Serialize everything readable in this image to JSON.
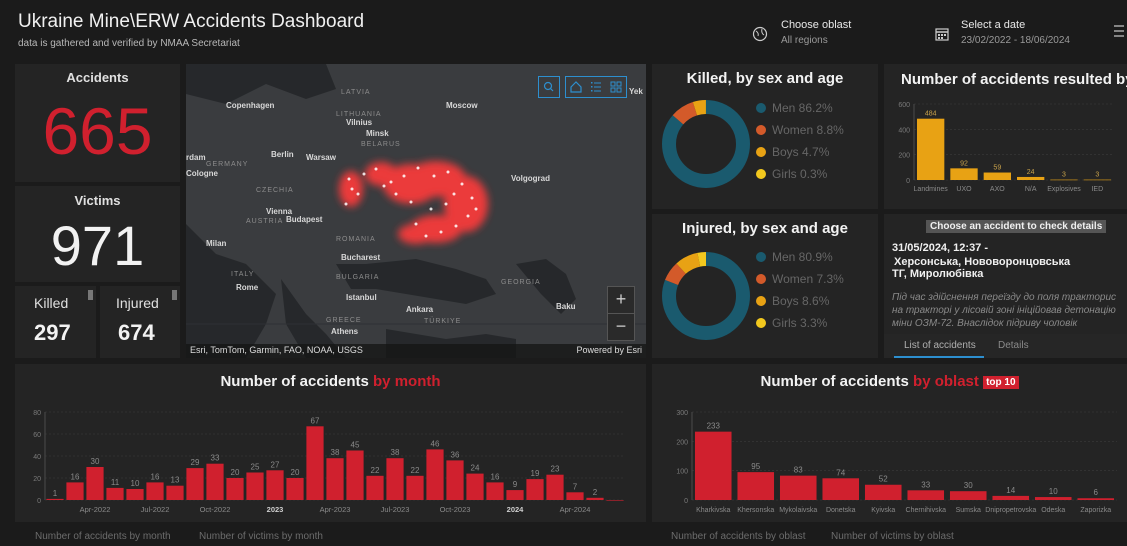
{
  "header": {
    "title": "Ukraine Mine\\ERW Accidents Dashboard",
    "subtitle": "data is gathered and verified by NMAA Secretariat",
    "oblast_label": "Choose oblast",
    "oblast_value": "All regions",
    "date_label": "Select a date",
    "date_value": "23/02/2022 - 18/06/2024"
  },
  "indicators": {
    "accidents_label": "Accidents",
    "accidents_value": "665",
    "victims_label": "Victims",
    "victims_value": "971",
    "killed_label": "Killed",
    "killed_value": "297",
    "injured_label": "Injured",
    "injured_value": "674"
  },
  "map": {
    "labels": [
      "LATVIA",
      "Moscow",
      "Copenhagen",
      "LITHUANIA",
      "Vilnius",
      "Minsk",
      "BELARUS",
      "Berlin",
      "GERMANY",
      "rdam",
      "Cologne",
      "Warsaw",
      "CZECHIA",
      "Vienna",
      "AUSTRIA",
      "Budapest",
      "Milan",
      "ROMANIA",
      "Bucharest",
      "BULGARIA",
      "ITALY",
      "Rome",
      "Istanbul",
      "GREECE",
      "Athens",
      "Ankara",
      "TÜRKIYE",
      "GEORGIA",
      "Baku",
      "Volgograd",
      "Yek"
    ],
    "attribution": "Esri, TomTom, Garmin, FAO, NOAA, USGS",
    "powered": "Powered by Esri",
    "zoom_in": "+",
    "zoom_out": "−"
  },
  "killed_chart": {
    "title": "Killed, by sex and age",
    "chart_data": {
      "type": "pie",
      "categories": [
        "Men",
        "Women",
        "Boys",
        "Girls"
      ],
      "values": [
        86.2,
        8.8,
        4.7,
        0.3
      ],
      "labels": [
        "Men 86.2%",
        "Women 8.8%",
        "Boys 4.7%",
        "Girls 0.3%"
      ],
      "colors": [
        "#1a5a6e",
        "#d35a2a",
        "#e8a214",
        "#f2c81e"
      ]
    }
  },
  "injured_chart": {
    "title": "Injured, by sex and age",
    "chart_data": {
      "type": "pie",
      "categories": [
        "Men",
        "Women",
        "Boys",
        "Girls"
      ],
      "values": [
        80.9,
        7.3,
        8.6,
        3.3
      ],
      "labels": [
        "Men 80.9%",
        "Women 7.3%",
        "Boys 8.6%",
        "Girls 3.3%"
      ],
      "colors": [
        "#1a5a6e",
        "#d35a2a",
        "#e8a214",
        "#f2c81e"
      ]
    }
  },
  "type_chart": {
    "title": "Number of accidents resulted by",
    "chart_data": {
      "type": "bar",
      "categories": [
        "Landmines",
        "UXO",
        "AXO",
        "N/A",
        "Explosives",
        "IED"
      ],
      "values": [
        484,
        92,
        59,
        24,
        3,
        3
      ],
      "ylim": [
        0,
        600
      ],
      "yticks": [
        "0",
        "200",
        "400",
        "600"
      ],
      "color": "#e8a214"
    }
  },
  "details": {
    "header": "Choose an accident to check details",
    "date": "31/05/2024, 12:37 -",
    "place1": "Херсонська, Нововоронцовська",
    "place2": "ТГ, Миролюбівка",
    "text1": "Під час здійснення переїзду до поля тракторис",
    "text2": "на тракторі у лісовій зоні ініційовав детонацію",
    "text3": "міни ОЗМ-72. Внаслідок підриву чоловік",
    "tab_list": "List of accidents",
    "tab_details": "Details"
  },
  "month_chart": {
    "title_main": "Number of accidents ",
    "title_red": "by month",
    "chart_data": {
      "type": "bar",
      "x": [
        "Feb-2022",
        "Mar-2022",
        "Apr-2022",
        "May-2022",
        "Jun-2022",
        "Jul-2022",
        "Aug-2022",
        "Sep-2022",
        "Oct-2022",
        "Nov-2022",
        "Dec-2022",
        "2023",
        "Feb-2023",
        "Mar-2023",
        "Apr-2023",
        "May-2023",
        "Jun-2023",
        "Jul-2023",
        "Aug-2023",
        "Sep-2023",
        "Oct-2023",
        "Nov-2023",
        "Dec-2023",
        "2024",
        "Feb-2024",
        "Mar-2024",
        "Apr-2024",
        "May-2024",
        "Jun-2024"
      ],
      "values": [
        1,
        16,
        30,
        11,
        10,
        16,
        13,
        29,
        33,
        20,
        25,
        27,
        20,
        67,
        38,
        45,
        22,
        38,
        22,
        46,
        36,
        24,
        16,
        9,
        19,
        23,
        7,
        2,
        0
      ],
      "ylim": [
        0,
        80
      ],
      "yticks": [
        "0",
        "20",
        "40",
        "60",
        "80"
      ],
      "xtick_labels": [
        "Apr-2022",
        "Jul-2022",
        "Oct-2022",
        "2023",
        "Apr-2023",
        "Jul-2023",
        "Oct-2023",
        "2024",
        "Apr-2024"
      ],
      "color": "#d0202e"
    },
    "tab1": "Number of accidents by month",
    "tab2": "Number of victims by month"
  },
  "oblast_chart": {
    "title_main": "Number of accidents ",
    "title_red": "by oblast",
    "badge": "top 10",
    "chart_data": {
      "type": "bar",
      "categories": [
        "Kharkivska",
        "Khersonska",
        "Mykolaivska",
        "Donetska",
        "Kyivska",
        "Chernihivska",
        "Sumska",
        "Dnipropetrovska",
        "Odeska",
        "Zaporizka"
      ],
      "values": [
        233,
        95,
        83,
        74,
        52,
        33,
        30,
        14,
        10,
        6
      ],
      "ylim": [
        0,
        300
      ],
      "yticks": [
        "0",
        "100",
        "200",
        "300"
      ],
      "color": "#d0202e"
    },
    "tab1": "Number of accidents by oblast",
    "tab2": "Number of victims by oblast"
  }
}
